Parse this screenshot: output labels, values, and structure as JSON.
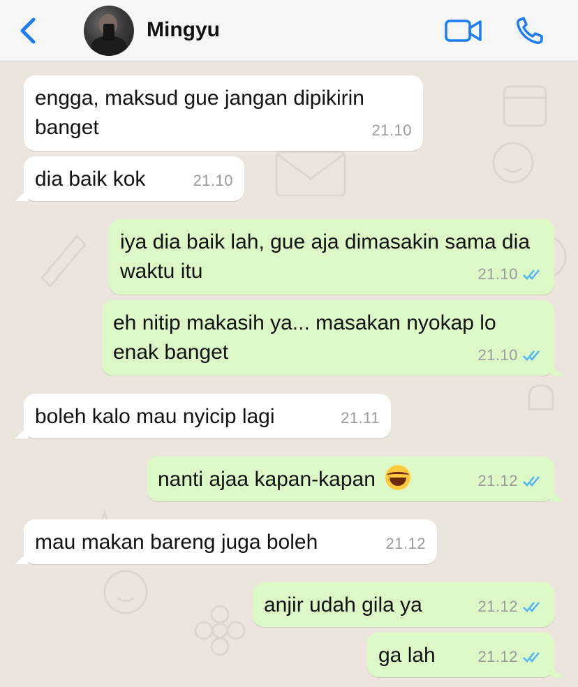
{
  "header": {
    "contact_name": "Mingyu",
    "back_icon": "chevron-left-icon",
    "video_icon": "video-camera-icon",
    "call_icon": "phone-icon",
    "accent": "#1A7CF6"
  },
  "colors": {
    "incoming": "#FFFFFF",
    "outgoing": "#DCF8C6",
    "wallpaper": "#ECE5DD",
    "read_tick": "#4FB3F6"
  },
  "messages": [
    {
      "direction": "in",
      "text": "engga, maksud gue jangan dipikirin banget",
      "time": "21.10"
    },
    {
      "direction": "in",
      "text": "dia baik kok",
      "time": "21.10"
    },
    {
      "direction": "out",
      "text": "iya dia baik lah, gue aja dimasakin sama dia waktu itu",
      "time": "21.10",
      "status": "read"
    },
    {
      "direction": "out",
      "text": "eh nitip makasih ya... masakan nyokap lo enak banget",
      "time": "21.10",
      "status": "read"
    },
    {
      "direction": "in",
      "text": "boleh kalo mau nyicip lagi",
      "time": "21.11"
    },
    {
      "direction": "out",
      "text": "nanti ajaa kapan-kapan",
      "emoji": "face-with-tears-of-joy",
      "time": "21.12",
      "status": "read"
    },
    {
      "direction": "in",
      "text": "mau makan bareng juga boleh",
      "time": "21.12"
    },
    {
      "direction": "out",
      "text": "anjir udah gila ya",
      "time": "21.12",
      "status": "read"
    },
    {
      "direction": "out",
      "text": "ga lah",
      "time": "21.12",
      "status": "read"
    }
  ]
}
